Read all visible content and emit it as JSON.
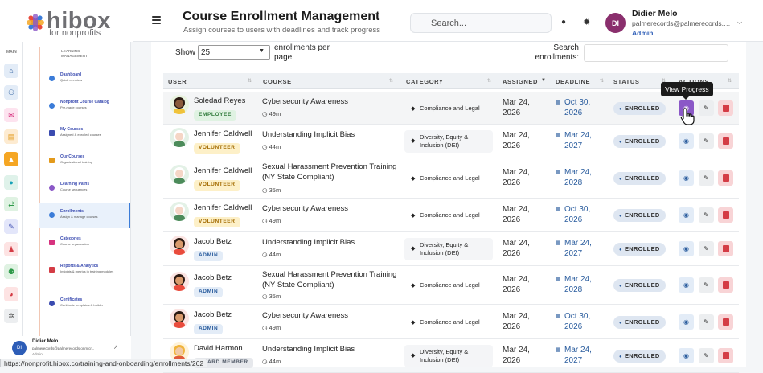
{
  "brand": {
    "name": "hibox",
    "sub": "for nonprofits"
  },
  "rail": {
    "main_label": "MAIN"
  },
  "nav": {
    "section_label": "LEARNING MANAGEMENT",
    "items": [
      {
        "title": "Dashboard",
        "sub": "Quick overview",
        "color": "#3b7cd8"
      },
      {
        "title": "Nonprofit Course Catalog",
        "sub": "Pre-made courses",
        "color": "#3b7cd8"
      },
      {
        "title": "My Courses",
        "sub": "Assigned & enrolled courses",
        "color": "#3a4bb0"
      },
      {
        "title": "Our Courses",
        "sub": "Organizational training",
        "color": "#e39a1b"
      },
      {
        "title": "Learning Paths",
        "sub": "Course sequences",
        "color": "#8b58c7"
      },
      {
        "title": "Enrollments",
        "sub": "Assign & manage courses",
        "color": "#3b7cd8"
      },
      {
        "title": "Categories",
        "sub": "Course organization",
        "color": "#d6337f"
      },
      {
        "title": "Reports & Analytics",
        "sub": "Insights & metrics in training modules",
        "color": "#d43c45"
      },
      {
        "title": "Certificates",
        "sub": "Certificate templates & builder",
        "color": "#3a4bb0"
      }
    ]
  },
  "bottom_user": {
    "initials": "DI",
    "name": "Didier Melo",
    "email": "palmerecords@palmerecords.onmicr...",
    "role": "Admin"
  },
  "header": {
    "title": "Course Enrollment Management",
    "subtitle": "Assign courses to users with deadlines and track progress",
    "search_placeholder": "Search...",
    "user_initials": "DI",
    "user_name": "Didier Melo",
    "user_email": "palmerecords@palmerecords.onmicrosoft.com",
    "user_role": "Admin"
  },
  "table_controls": {
    "show_label": "Show",
    "show_value": "25",
    "show_after": "enrollments per page",
    "search_label": "Search enrollments:"
  },
  "columns": [
    "USER",
    "COURSE",
    "CATEGORY",
    "ASSIGNED",
    "DEADLINE",
    "STATUS",
    "ACTIONS"
  ],
  "rows": [
    {
      "name": "Soledad Reyes",
      "role": "EMPLOYEE",
      "course": "Cybersecurity Awareness",
      "dur": "49m",
      "category": "Compliance and Legal",
      "assigned": "Mar 24, 2026",
      "deadline": "Oct 30, 2026",
      "status": "ENROLLED"
    },
    {
      "name": "Jennifer Caldwell",
      "role": "VOLUNTEER",
      "course": "Understanding Implicit Bias",
      "dur": "44m",
      "category": "Diversity, Equity & Inclusion (DEI)",
      "assigned": "Mar 24, 2026",
      "deadline": "Mar 24, 2027",
      "status": "ENROLLED"
    },
    {
      "name": "Jennifer Caldwell",
      "role": "VOLUNTEER",
      "course": "Sexual Harassment Prevention Training (NY State Compliant)",
      "dur": "35m",
      "category": "Compliance and Legal",
      "assigned": "Mar 24, 2026",
      "deadline": "Mar 24, 2028",
      "status": "ENROLLED"
    },
    {
      "name": "Jennifer Caldwell",
      "role": "VOLUNTEER",
      "course": "Cybersecurity Awareness",
      "dur": "49m",
      "category": "Compliance and Legal",
      "assigned": "Mar 24, 2026",
      "deadline": "Oct 30, 2026",
      "status": "ENROLLED"
    },
    {
      "name": "Jacob Betz",
      "role": "ADMIN",
      "course": "Understanding Implicit Bias",
      "dur": "44m",
      "category": "Diversity, Equity & Inclusion (DEI)",
      "assigned": "Mar 24, 2026",
      "deadline": "Mar 24, 2027",
      "status": "ENROLLED"
    },
    {
      "name": "Jacob Betz",
      "role": "ADMIN",
      "course": "Sexual Harassment Prevention Training (NY State Compliant)",
      "dur": "35m",
      "category": "Compliance and Legal",
      "assigned": "Mar 24, 2026",
      "deadline": "Mar 24, 2028",
      "status": "ENROLLED"
    },
    {
      "name": "Jacob Betz",
      "role": "ADMIN",
      "course": "Cybersecurity Awareness",
      "dur": "49m",
      "category": "Compliance and Legal",
      "assigned": "Mar 24, 2026",
      "deadline": "Oct 30, 2026",
      "status": "ENROLLED"
    },
    {
      "name": "David Harmon",
      "role": "BOARD MEMBER",
      "course": "Understanding Implicit Bias",
      "dur": "44m",
      "category": "Diversity, Equity & Inclusion (DEI)",
      "assigned": "Mar 24, 2026",
      "deadline": "Mar 24, 2027",
      "status": "ENROLLED"
    }
  ],
  "tooltip": "View Progress",
  "status_url": "https://nonprofit.hibox.co/training-and-onboarding/enrollments/262"
}
